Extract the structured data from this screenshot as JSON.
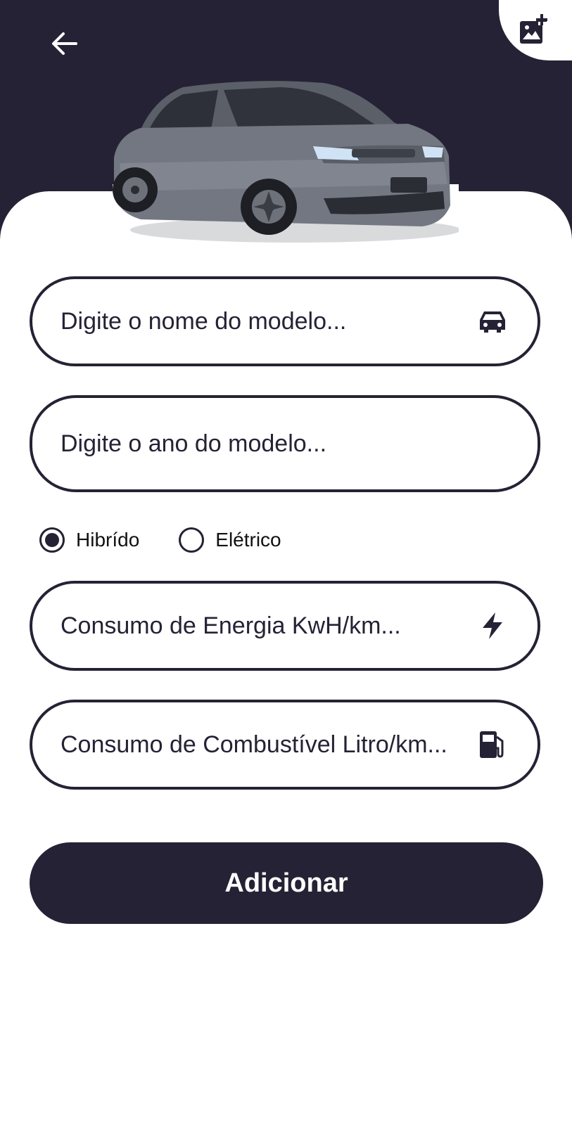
{
  "header": {
    "back_icon": "arrow-left-icon",
    "add_photo_icon": "add-photo-icon",
    "background_color": "#262235"
  },
  "form": {
    "model_name": {
      "placeholder": "Digite o nome do modelo...",
      "value": "",
      "icon": "car-icon"
    },
    "model_year": {
      "placeholder": "Digite o ano do modelo...",
      "value": ""
    },
    "vehicle_type": {
      "options": [
        {
          "label": "Hibrído",
          "selected": true
        },
        {
          "label": "Elétrico",
          "selected": false
        }
      ]
    },
    "energy_consumption": {
      "placeholder": "Consumo de Energia KwH/km...",
      "value": "",
      "icon": "lightning-icon"
    },
    "fuel_consumption": {
      "placeholder": "Consumo de Combustível Litro/km...",
      "value": "",
      "icon": "fuel-pump-icon"
    },
    "submit_label": "Adicionar"
  },
  "colors": {
    "primary": "#262235",
    "background": "#ffffff",
    "car_body": "#6b6f78"
  }
}
